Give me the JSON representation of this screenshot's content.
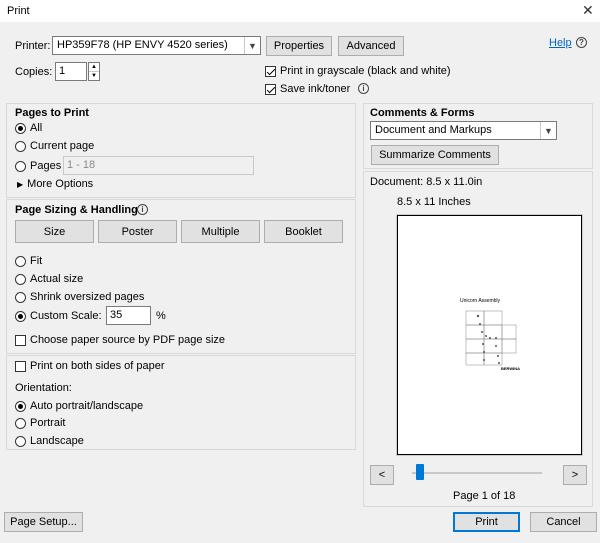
{
  "window": {
    "title": "Print",
    "close_glyph": "✕"
  },
  "printer": {
    "label": "Printer:",
    "selected": "HP359F78 (HP ENVY 4520 series)",
    "properties_label": "Properties",
    "advanced_label": "Advanced",
    "help_label": "Help"
  },
  "copies": {
    "label": "Copies:",
    "value": "1"
  },
  "options": {
    "grayscale_label": "Print in grayscale (black and white)",
    "grayscale_checked": true,
    "save_ink_label": "Save ink/toner",
    "save_ink_checked": true
  },
  "pages_to_print": {
    "title": "Pages to Print",
    "all_label": "All",
    "current_page_label": "Current page",
    "pages_label": "Pages",
    "pages_range_value": "1 - 18",
    "more_options_label": "More Options",
    "selected": "all"
  },
  "page_sizing": {
    "title": "Page Sizing & Handling",
    "tabs": [
      {
        "label": "Size"
      },
      {
        "label": "Poster"
      },
      {
        "label": "Multiple"
      },
      {
        "label": "Booklet"
      }
    ],
    "active_tab": 0,
    "fit_label": "Fit",
    "actual_size_label": "Actual size",
    "shrink_label": "Shrink oversized pages",
    "custom_scale_label": "Custom Scale:",
    "custom_scale_value": "35",
    "percent_label": "%",
    "choose_source_label": "Choose paper source by PDF page size",
    "selected": "custom"
  },
  "duplex": {
    "label": "Print on both sides of paper",
    "checked": false
  },
  "orientation": {
    "title": "Orientation:",
    "auto_label": "Auto portrait/landscape",
    "portrait_label": "Portrait",
    "landscape_label": "Landscape",
    "selected": "auto"
  },
  "comments_forms": {
    "title": "Comments & Forms",
    "selected": "Document and Markups",
    "summarize_label": "Summarize Comments"
  },
  "preview": {
    "document_size": "Document: 8.5 x 11.0in",
    "paper_size": "8.5 x 11 Inches",
    "doc_title": "Unicorn Assembly",
    "doc_logo": "BERWINA",
    "prev_glyph": "<",
    "next_glyph": ">",
    "page_indicator": "Page 1 of 18",
    "slider_fraction": 0.0
  },
  "footer": {
    "page_setup_label": "Page Setup...",
    "print_label": "Print",
    "cancel_label": "Cancel"
  }
}
